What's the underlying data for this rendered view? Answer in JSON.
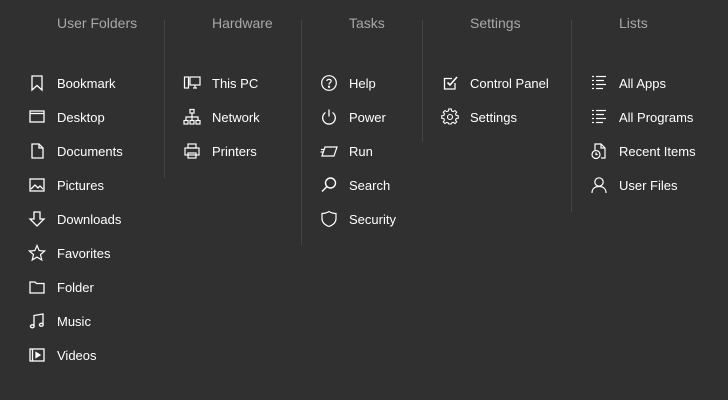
{
  "colors": {
    "background": "#303030",
    "header": "#a8a8a8",
    "text": "#ffffff",
    "divider": "#444444"
  },
  "columns": [
    {
      "header": "User Folders",
      "items": [
        {
          "label": "Bookmark",
          "icon": "bookmark-icon"
        },
        {
          "label": "Desktop",
          "icon": "desktop-icon"
        },
        {
          "label": "Documents",
          "icon": "document-icon"
        },
        {
          "label": "Pictures",
          "icon": "picture-icon"
        },
        {
          "label": "Downloads",
          "icon": "download-icon"
        },
        {
          "label": "Favorites",
          "icon": "star-icon"
        },
        {
          "label": "Folder",
          "icon": "folder-icon"
        },
        {
          "label": "Music",
          "icon": "music-icon"
        },
        {
          "label": "Videos",
          "icon": "video-icon"
        }
      ]
    },
    {
      "header": "Hardware",
      "items": [
        {
          "label": "This PC",
          "icon": "computer-icon"
        },
        {
          "label": "Network",
          "icon": "network-icon"
        },
        {
          "label": "Printers",
          "icon": "printer-icon"
        }
      ]
    },
    {
      "header": "Tasks",
      "items": [
        {
          "label": "Help",
          "icon": "help-icon"
        },
        {
          "label": "Power",
          "icon": "power-icon"
        },
        {
          "label": "Run",
          "icon": "run-icon"
        },
        {
          "label": "Search",
          "icon": "search-icon"
        },
        {
          "label": "Security",
          "icon": "shield-icon"
        }
      ]
    },
    {
      "header": "Settings",
      "items": [
        {
          "label": "Control Panel",
          "icon": "checkbox-icon"
        },
        {
          "label": "Settings",
          "icon": "gear-icon"
        }
      ]
    },
    {
      "header": "Lists",
      "items": [
        {
          "label": "All Apps",
          "icon": "list-icon"
        },
        {
          "label": "All Programs",
          "icon": "list-icon"
        },
        {
          "label": "Recent Items",
          "icon": "recent-icon"
        },
        {
          "label": "User Files",
          "icon": "user-icon"
        }
      ]
    }
  ]
}
